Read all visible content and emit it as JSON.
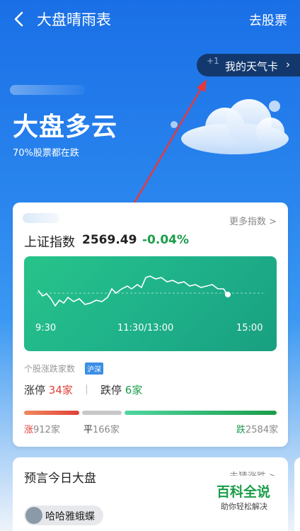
{
  "header": {
    "title": "大盘晴雨表",
    "right_link": "去股票"
  },
  "weather_card": {
    "plus": "+1",
    "label": "我的天气卡",
    "chevron": "›"
  },
  "hero": {
    "headline": "大盘多云",
    "subtitle": "70%股票都在跌"
  },
  "index_card": {
    "more_link": "更多指数 >",
    "index_name": "上证指数",
    "index_value": "2569.49",
    "index_change": "-0.04%",
    "times": [
      "9:30",
      "11:30/13:00",
      "15:00"
    ],
    "breadth_title": "个股涨跌家数",
    "breadth_tag": "沪深",
    "limit_up_label": "涨停",
    "limit_up_value": "34家",
    "limit_down_label": "跌停",
    "limit_down_value": "6家",
    "rise_label": "涨",
    "rise_value": "912家",
    "flat_label": "平",
    "flat_value": "166家",
    "fall_label": "跌",
    "fall_value": "2584家",
    "colors": {
      "up": "#e0403a",
      "down": "#1b9d4a",
      "flat": "#c8c8c8"
    }
  },
  "predict_card": {
    "title": "预言今日大盘",
    "link": "去猜涨跌 >",
    "user_name": "哈哈雅蛾蝶"
  },
  "watermark": {
    "main": "百科全说",
    "sub": "助你轻松解决"
  }
}
